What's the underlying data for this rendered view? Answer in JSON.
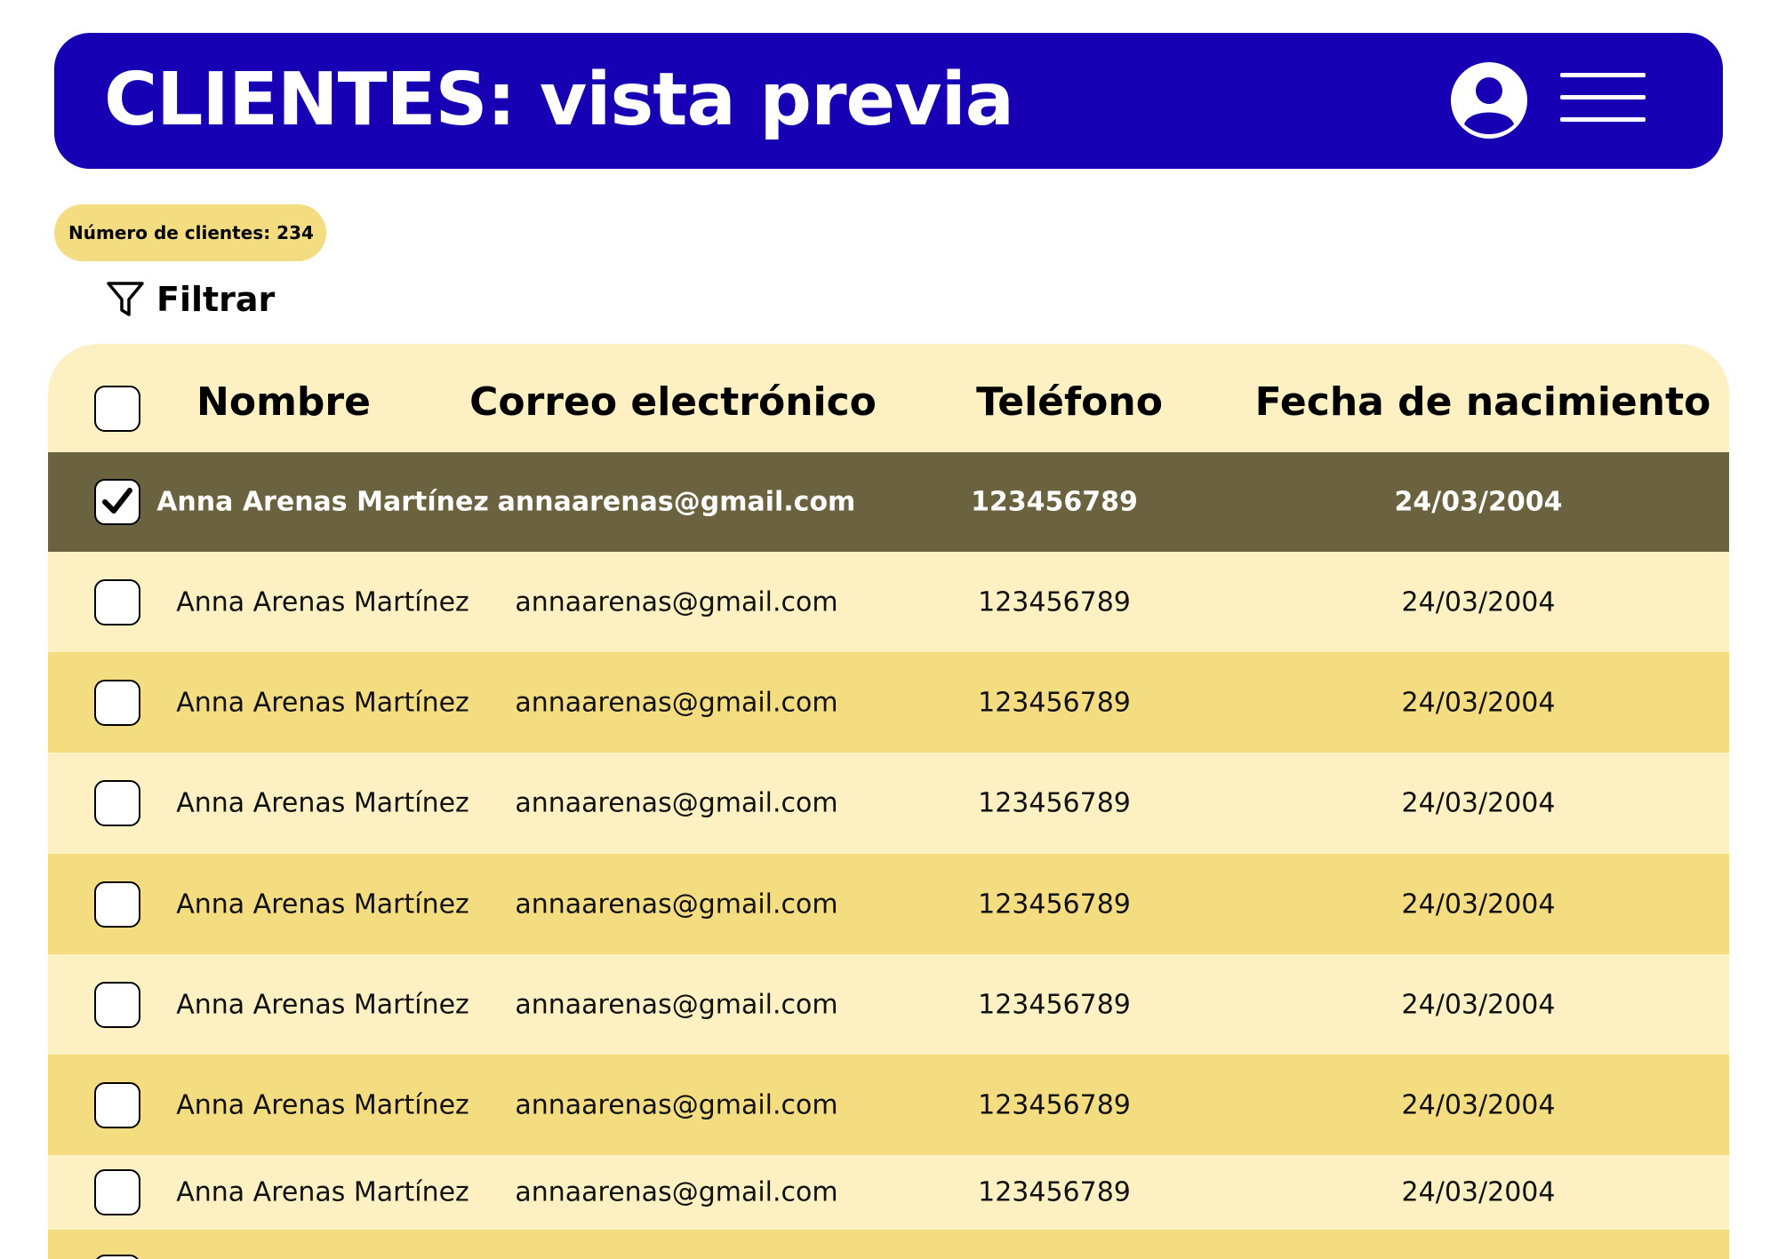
{
  "header": {
    "title": "CLIENTES: vista previa"
  },
  "summary": {
    "client_count_label": "Número de clientes: 234"
  },
  "filter": {
    "label": "Filtrar"
  },
  "table": {
    "columns": [
      "Nombre",
      "Correo electrónico",
      "Teléfono",
      "Fecha de nacimiento"
    ],
    "rows": [
      {
        "name": "Anna Arenas Martínez",
        "email": "annaarenas@gmail.com",
        "phone": "123456789",
        "birthdate": "24/03/2004",
        "checked": true
      },
      {
        "name": "Anna Arenas Martínez",
        "email": "annaarenas@gmail.com",
        "phone": "123456789",
        "birthdate": "24/03/2004",
        "checked": false
      },
      {
        "name": "Anna Arenas Martínez",
        "email": "annaarenas@gmail.com",
        "phone": "123456789",
        "birthdate": "24/03/2004",
        "checked": false
      },
      {
        "name": "Anna Arenas Martínez",
        "email": "annaarenas@gmail.com",
        "phone": "123456789",
        "birthdate": "24/03/2004",
        "checked": false
      },
      {
        "name": "Anna Arenas Martínez",
        "email": "annaarenas@gmail.com",
        "phone": "123456789",
        "birthdate": "24/03/2004",
        "checked": false
      },
      {
        "name": "Anna Arenas Martínez",
        "email": "annaarenas@gmail.com",
        "phone": "123456789",
        "birthdate": "24/03/2004",
        "checked": false
      },
      {
        "name": "Anna Arenas Martínez",
        "email": "annaarenas@gmail.com",
        "phone": "123456789",
        "birthdate": "24/03/2004",
        "checked": false
      },
      {
        "name": "Anna Arenas Martínez",
        "email": "annaarenas@gmail.com",
        "phone": "123456789",
        "birthdate": "24/03/2004",
        "checked": false
      }
    ]
  },
  "icons": {
    "user": "user-icon",
    "menu": "hamburger-menu-icon",
    "filter": "filter-funnel-icon",
    "check": "check-icon"
  },
  "colors": {
    "header_bg": "#1700b3",
    "badge_bg": "#f4dc80",
    "row_light": "#fdf1c3",
    "row_dark": "#f4dc80",
    "row_selected": "#6b623f"
  }
}
